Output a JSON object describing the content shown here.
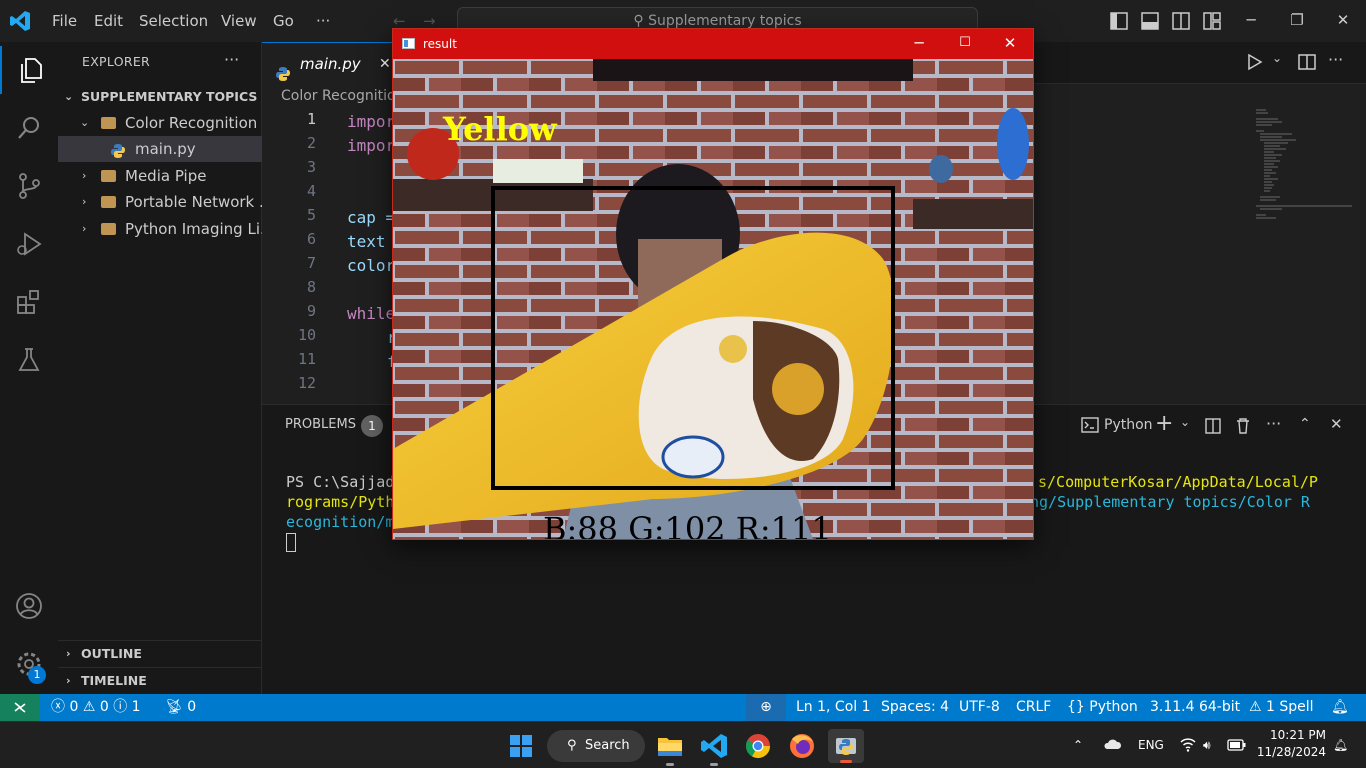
{
  "titlebar": {
    "menu": [
      "File",
      "Edit",
      "Selection",
      "View",
      "Go",
      "···"
    ],
    "command_center": "Supplementary topics"
  },
  "sidebar": {
    "header": "EXPLORER",
    "actions": "···",
    "workspace": "SUPPLEMENTARY TOPICS",
    "tree": [
      {
        "label": "Color Recognition",
        "kind": "folder-open"
      },
      {
        "label": "main.py",
        "kind": "file",
        "selected": true
      },
      {
        "label": "Media Pipe",
        "kind": "folder"
      },
      {
        "label": "Portable Network ...",
        "kind": "folder"
      },
      {
        "label": "Python Imaging Li...",
        "kind": "folder"
      }
    ],
    "outline": "OUTLINE",
    "timeline": "TIMELINE",
    "settings_badge": "1"
  },
  "editor": {
    "tab_label": "main.py",
    "tab_close": "✕",
    "breadcrumb": "Color Recognitio",
    "line_numbers": [
      "1",
      "2",
      "3",
      "4",
      "5",
      "6",
      "7",
      "8",
      "9",
      "10",
      "11",
      "12"
    ],
    "code": {
      "l1": "impor",
      "l2": "impor",
      "l5": "cap =",
      "l6": "text",
      "l7": "color",
      "l9": "while",
      "l10": "r",
      "l11": "f"
    }
  },
  "panel": {
    "tab": "PROBLEMS",
    "badge": "1",
    "terminal_label": "Python",
    "terminal": {
      "line1_left": "PS C:\\Sajjad",
      "line1_right": "s/ComputerKosar/AppData/Local/P",
      "line2_left": "rograms/Pyth",
      "line2_right": "ng/Supplementary topics/Color R",
      "line3_left": "ecognition/m"
    }
  },
  "statusbar": {
    "errors": "0",
    "warnings": "0",
    "infos": "1",
    "ports": "0",
    "position": "Ln 1, Col 1",
    "spaces": "Spaces: 4",
    "encoding": "UTF-8",
    "eol": "CRLF",
    "language": "Python",
    "interpreter": "3.11.4 64-bit",
    "spell": "1 Spell"
  },
  "taskbar": {
    "search": "Search",
    "lang": "ENG",
    "time": "10:21 PM",
    "date": "11/28/2024"
  },
  "result_window": {
    "title": "result",
    "color_label": "Yellow",
    "bgr_label": "B:88 G:102 R:111",
    "label_color": "#ffff00"
  },
  "colors": {
    "accent": "#0078d4",
    "statusbar": "#007acc",
    "remote": "#16825d",
    "cv_titlebar": "#d20f0f"
  }
}
